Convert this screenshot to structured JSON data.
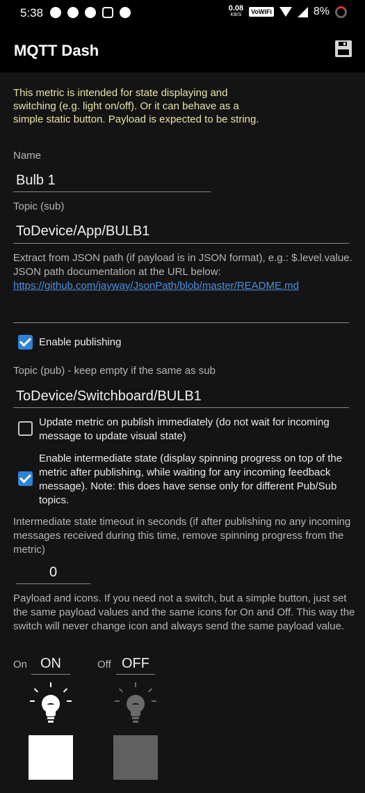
{
  "status_bar": {
    "time": "5:38",
    "net_speed": "0.08",
    "net_unit": "KB/S",
    "vowifi": "VoWiFi",
    "battery": "8%"
  },
  "app_bar": {
    "title": "MQTT Dash",
    "save_icon": "save-icon"
  },
  "info_text": "This metric is intended for state displaying and switching (e.g. light on/off). Or it can behave as a simple static button. Payload is expected to be string.",
  "name": {
    "label": "Name",
    "value": "Bulb 1"
  },
  "topic_sub": {
    "label": "Topic (sub)",
    "value": "ToDevice/App/BULB1"
  },
  "json_path": {
    "help": "Extract from JSON path (if payload is in JSON format), e.g.: $.level.value. JSON path documentation at the URL below:",
    "link": "https://github.com/jayway/JsonPath/blob/master/README.md",
    "value": ""
  },
  "enable_publishing": {
    "label": "Enable publishing",
    "checked": true
  },
  "topic_pub": {
    "label": "Topic (pub) - keep empty if the same as sub",
    "value": "ToDevice/Switchboard/BULB1"
  },
  "update_immediately": {
    "label": "Update metric on publish immediately (do not wait for incoming message to update visual state)",
    "checked": false
  },
  "intermediate_state": {
    "label": "Enable intermediate state (display spinning progress on top of the metric after publishing, while waiting for any incoming feedback message). Note: this does have sense only for different Pub/Sub topics.",
    "checked": true
  },
  "timeout": {
    "help": "Intermediate state timeout in seconds (if after publishing no any incoming messages received during this time, remove spinning progress from the metric)",
    "value": "0"
  },
  "payload_help": "Payload and icons. If you need not a switch, but a simple button, just set the same payload values and the same icons for On and Off. This way the switch will never change icon and always send the same payload value.",
  "on": {
    "label": "On",
    "value": "ON",
    "icon": "lightbulb-on-icon",
    "color": "#ffffff"
  },
  "off": {
    "label": "Off",
    "value": "OFF",
    "icon": "lightbulb-off-icon",
    "color": "#606060"
  },
  "colors": {
    "accent": "#2f83d6",
    "info": "#e9e4a6",
    "link": "#4d8fe0"
  }
}
